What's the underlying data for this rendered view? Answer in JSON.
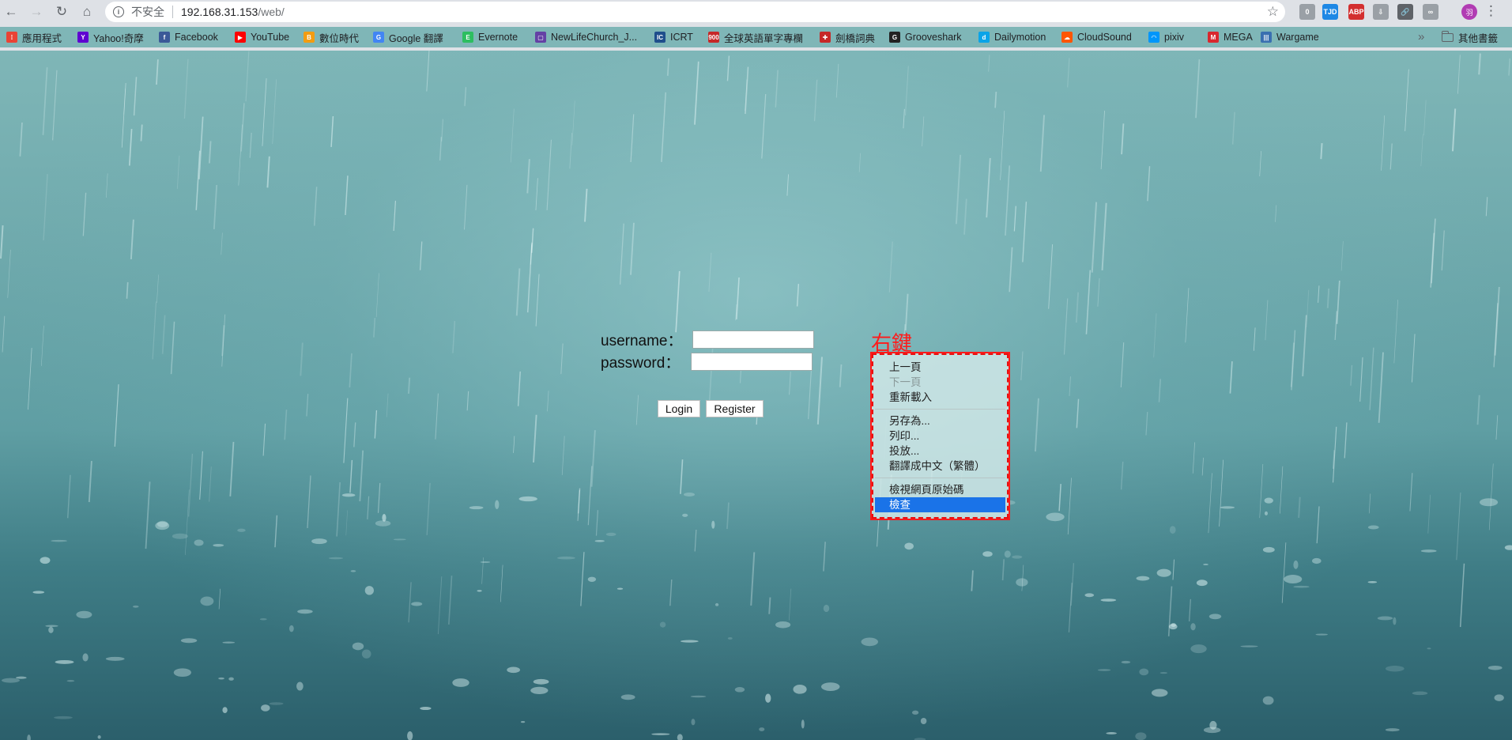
{
  "browser": {
    "nav": {
      "back_icon": "arrow-left-icon",
      "forward_icon": "arrow-right-icon",
      "reload_icon": "reload-icon",
      "home_icon": "home-icon"
    },
    "omnibox": {
      "security_label": "不安全",
      "host": "192.168.31.153",
      "path": "/web/"
    },
    "extensions": [
      {
        "name": "ext-notification",
        "text": "0",
        "color": "#9aa0a6"
      },
      {
        "name": "ext-tjd",
        "text": "TJD",
        "color": "#1e88e5"
      },
      {
        "name": "ext-abp",
        "text": "ABP",
        "color": "#d32f2f"
      },
      {
        "name": "ext-download",
        "text": "⇩",
        "color": "#9aa0a6"
      },
      {
        "name": "ext-link",
        "text": "🔗",
        "color": "#5f6368"
      },
      {
        "name": "ext-glasses",
        "text": "∞",
        "color": "#9aa0a6"
      }
    ],
    "avatar_text": "羽"
  },
  "bookmarks": {
    "items": [
      {
        "label": "應用程式",
        "icon_color": "#ea4335",
        "icon_text": "⁞"
      },
      {
        "label": "Yahoo!奇摩",
        "icon_color": "#5f01d1",
        "icon_text": "Y"
      },
      {
        "label": "Facebook",
        "icon_color": "#3b5998",
        "icon_text": "f"
      },
      {
        "label": "YouTube",
        "icon_color": "#ff0000",
        "icon_text": "▶"
      },
      {
        "label": "數位時代",
        "icon_color": "#f39c12",
        "icon_text": "B"
      },
      {
        "label": "Google 翻譯",
        "icon_color": "#4285f4",
        "icon_text": "G"
      },
      {
        "label": "Evernote",
        "icon_color": "#2dbe60",
        "icon_text": "E"
      },
      {
        "label": "NewLifeChurch_J...",
        "icon_color": "#6441a5",
        "icon_text": "▢"
      },
      {
        "label": "ICRT",
        "icon_color": "#1f4e8c",
        "icon_text": "IC"
      },
      {
        "label": "全球英語單字專欄",
        "icon_color": "#c62828",
        "icon_text": "900"
      },
      {
        "label": "劍橋詞典",
        "icon_color": "#c62828",
        "icon_text": "✚"
      },
      {
        "label": "Grooveshark",
        "icon_color": "#222222",
        "icon_text": "G"
      },
      {
        "label": "Dailymotion",
        "icon_color": "#0aa4e8",
        "icon_text": "d"
      },
      {
        "label": "CloudSound",
        "icon_color": "#ff5500",
        "icon_text": "☁"
      },
      {
        "label": "pixiv",
        "icon_color": "#0096fa",
        "icon_text": "◠"
      },
      {
        "label": "MEGA",
        "icon_color": "#d9272e",
        "icon_text": "M"
      },
      {
        "label": "Wargame",
        "icon_color": "#3a6fb0",
        "icon_text": "|||"
      }
    ],
    "more_label": "»",
    "folder_label": "其他書籤"
  },
  "login": {
    "username_label": "username：",
    "password_label": "password：",
    "username_value": "",
    "password_value": "",
    "login_button": "Login",
    "register_button": "Register"
  },
  "annotation": {
    "label": "右鍵"
  },
  "context_menu": {
    "groups": [
      [
        {
          "label": "上一頁",
          "state": "normal"
        },
        {
          "label": "下一頁",
          "state": "disabled"
        },
        {
          "label": "重新載入",
          "state": "normal"
        }
      ],
      [
        {
          "label": "另存為...",
          "state": "normal"
        },
        {
          "label": "列印...",
          "state": "normal"
        },
        {
          "label": "投放...",
          "state": "normal"
        },
        {
          "label": "翻譯成中文（繁體）",
          "state": "normal"
        }
      ],
      [
        {
          "label": "檢視網頁原始碼",
          "state": "normal"
        },
        {
          "label": "檢查",
          "state": "active"
        }
      ]
    ]
  },
  "colors": {
    "annotation_red": "#ff1a1a",
    "highlight_blue": "#1a73e8",
    "chrome_bg": "#dee1e6",
    "bookmark_bar_bg": "#7fb6b7"
  }
}
